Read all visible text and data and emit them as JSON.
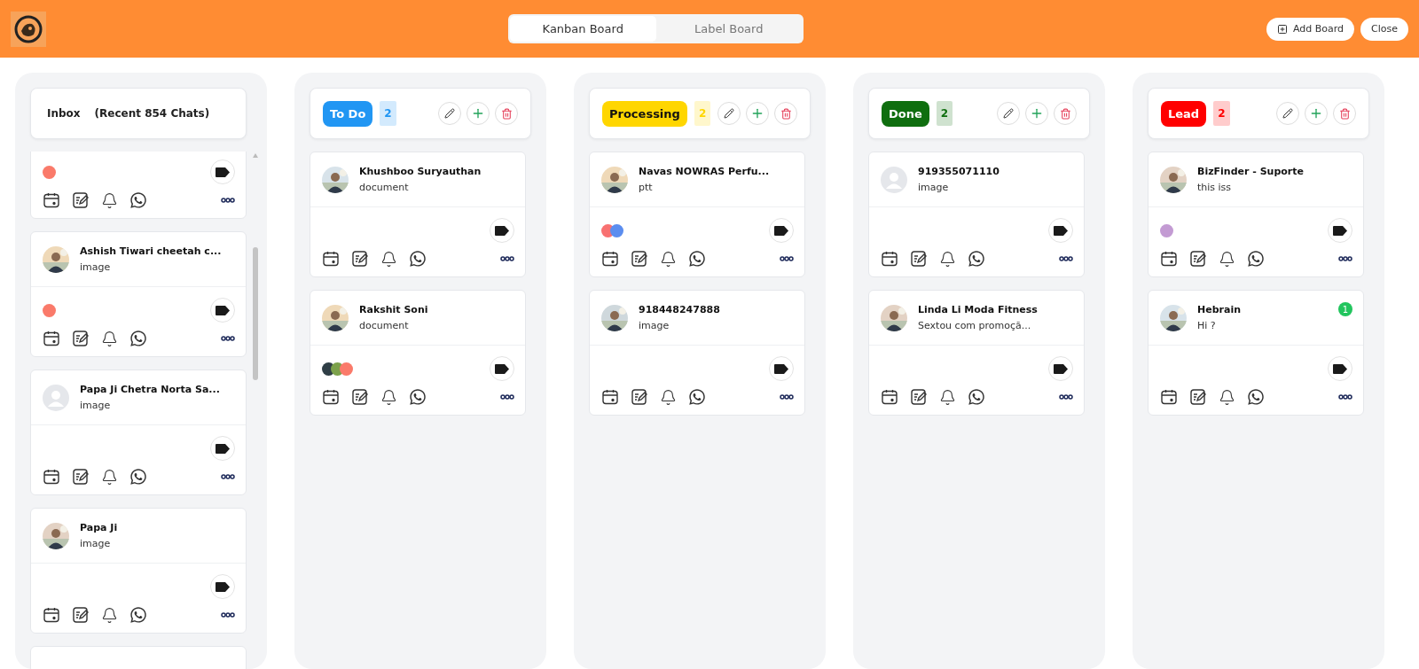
{
  "header": {
    "tabs": [
      {
        "label": "Kanban Board",
        "selected": true
      },
      {
        "label": "Label Board",
        "selected": false
      }
    ],
    "buttons": [
      {
        "label": "Add Board",
        "kind": "add"
      },
      {
        "label": "Close",
        "kind": "plain"
      }
    ]
  },
  "inbox": {
    "title": "Inbox",
    "subtitle": "(Recent 854 Chats)",
    "chats": [
      {
        "labels": [
          {
            "color": "#fa7a6a"
          }
        ]
      },
      {
        "name": "Ashish Tiwari cheetah c...",
        "preview": "image",
        "labels": [
          {
            "color": "#fa7a6a"
          }
        ]
      },
      {
        "name": "Papa Ji Chetra Norta Sa...",
        "preview": "image",
        "kind": "default"
      },
      {
        "name": "Papa Ji",
        "preview": "image"
      }
    ]
  },
  "columns": [
    {
      "title": "To Do",
      "count": "2",
      "color": "#2196f3",
      "chats": [
        {
          "name": "Khushboo Suryauthan",
          "preview": "document"
        },
        {
          "name": "Rakshit Soni",
          "preview": "document",
          "labels": [
            {
              "color": "#2f3e46"
            },
            {
              "color": "#7ca14b"
            },
            {
              "color": "#fa7a6a"
            }
          ]
        }
      ]
    },
    {
      "title": "Processing",
      "count": "2",
      "color": "#ffd600",
      "chats": [
        {
          "name": "Navas NOWRAS Perfu...",
          "preview": "ptt",
          "labels": [
            {
              "color": "#f87171"
            },
            {
              "color": "#5b8def"
            }
          ]
        },
        {
          "name": "918448247888",
          "preview": "image"
        }
      ]
    },
    {
      "title": "Done",
      "count": "2",
      "color": "#0f6e0f",
      "chats": [
        {
          "name": "919355071110",
          "preview": "image",
          "kind": "default"
        },
        {
          "name": "Linda Li Moda Fitness",
          "preview": "Sextou com promoçã..."
        }
      ]
    },
    {
      "title": "Lead",
      "count": "2",
      "color": "#ff0000",
      "chats": [
        {
          "name": "BizFinder - Suporte",
          "preview": "this iss",
          "labels": [
            {
              "color": "#c39bd3"
            }
          ]
        },
        {
          "name": "Hebrain",
          "preview": "Hi ?",
          "unread": "1"
        }
      ]
    }
  ]
}
